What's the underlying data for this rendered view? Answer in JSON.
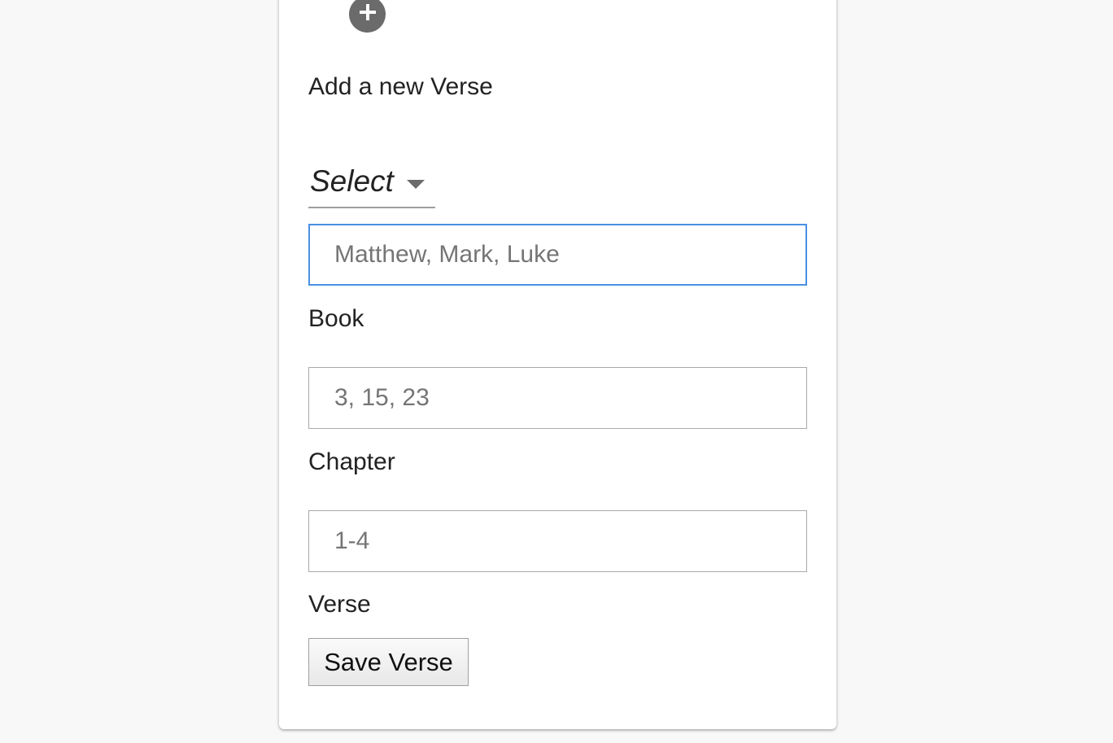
{
  "form": {
    "heading": "Add a new Verse",
    "select": {
      "value": "Select"
    },
    "book": {
      "placeholder": "Matthew, Mark, Luke",
      "label": "Book"
    },
    "chapter": {
      "placeholder": "3, 15, 23",
      "label": "Chapter"
    },
    "verse": {
      "placeholder": "1-4",
      "label": "Verse"
    },
    "save_label": "Save Verse"
  },
  "icons": {
    "add": "plus-circle-icon",
    "select_caret": "caret-down-icon"
  },
  "colors": {
    "page_background": "#f8f8f8",
    "card_background": "#ffffff",
    "focus_border": "#4a90e2",
    "icon_gray": "#6b6b6b"
  }
}
